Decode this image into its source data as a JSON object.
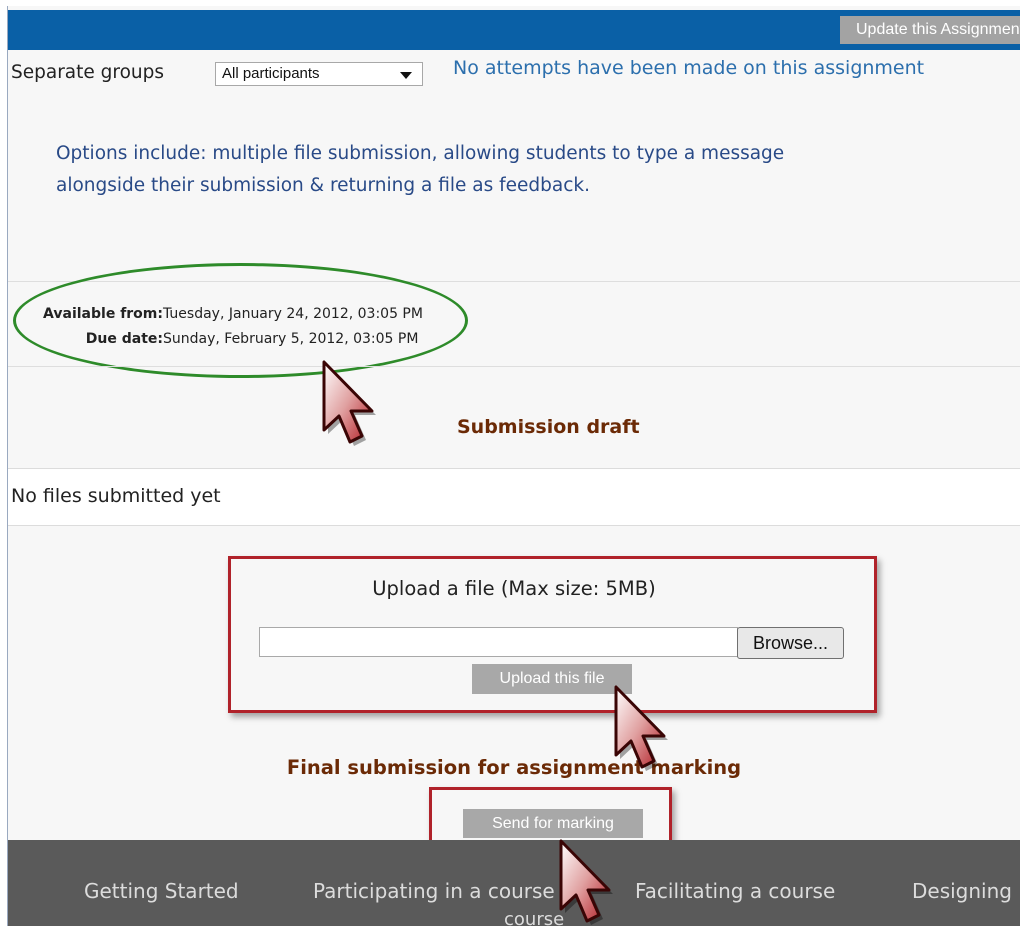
{
  "header": {
    "update_button": "Update this Assignment"
  },
  "groups": {
    "label": "Separate groups",
    "selected": "All participants"
  },
  "status": {
    "no_attempts": "No attempts have been made on this assignment"
  },
  "options_note": "Options include: multiple file submission, allowing students to type a message alongside their submission & returning a file as feedback.",
  "dates": {
    "available_label": "Available from:",
    "available_value": "Tuesday, January 24, 2012, 03:05 PM",
    "due_label": "Due date:",
    "due_value": "Sunday, February 5, 2012, 03:05 PM"
  },
  "draft": {
    "title": "Submission draft",
    "empty": "No files submitted yet"
  },
  "upload": {
    "title": "Upload a file (Max size: 5MB)",
    "browse": "Browse...",
    "upload_button": "Upload this file"
  },
  "final": {
    "title": "Final submission for assignment marking",
    "send_button": "Send for marking"
  },
  "footer": {
    "links": [
      "Getting Started",
      "Participating in a course",
      "Facilitating a course",
      "Designing"
    ],
    "wrap": "course"
  },
  "colors": {
    "accent": "#0a60a6",
    "annotation_red": "#b0222a",
    "annotation_green": "#2e8b2a"
  },
  "annotations": [
    "pointer-cursor",
    "pointer-cursor",
    "pointer-cursor"
  ]
}
